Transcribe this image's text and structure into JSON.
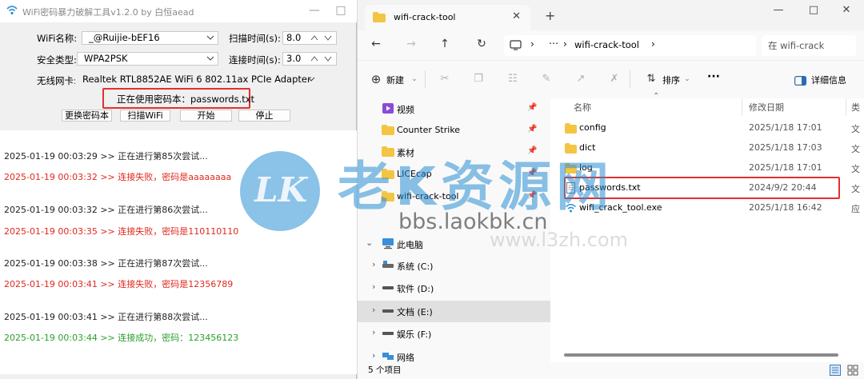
{
  "left_window": {
    "title": "WiFi密码暴力破解工具v1.2.0 by 白恒aead",
    "wifi_name_label": "WiFi名称:",
    "wifi_name_value": "_@Ruijie-bEF16",
    "security_label": "安全类型:",
    "security_value": "WPA2PSK",
    "adapter_label": "无线网卡:",
    "adapter_value": "Realtek RTL8852AE WiFi 6 802.11ax PCIe Adapter",
    "scan_time_label": "扫描时间(s):",
    "scan_time_value": "8.0",
    "connect_time_label": "连接时间(s):",
    "connect_time_value": "3.0",
    "current_pwd_text": "正在使用密码本：passwords.txt",
    "buttons": {
      "change_book": "更换密码本",
      "scan_wifi": "扫描WiFi",
      "start": "开始",
      "stop": "停止"
    },
    "log": [
      {
        "text": "2025-01-19 00:03:29 >> 正在进行第85次尝试...",
        "status": "progress"
      },
      {
        "text": "2025-01-19 00:03:32 >> 连接失败，密码是aaaaaaaa",
        "status": "fail"
      },
      {
        "text": "2025-01-19 00:03:32 >> 正在进行第86次尝试...",
        "status": "progress"
      },
      {
        "text": "2025-01-19 00:03:35 >> 连接失败，密码是110110110",
        "status": "fail"
      },
      {
        "text": "2025-01-19 00:03:38 >> 正在进行第87次尝试...",
        "status": "progress"
      },
      {
        "text": "2025-01-19 00:03:41 >> 连接失败，密码是12356789",
        "status": "fail"
      },
      {
        "text": "2025-01-19 00:03:41 >> 正在进行第88次尝试...",
        "status": "progress"
      },
      {
        "text": "2025-01-19 00:03:44 >> 连接成功，密码：123456123",
        "status": "success"
      }
    ]
  },
  "right_window": {
    "tab_title": "wifi-crack-tool",
    "breadcrumb_folder": "wifi-crack-tool",
    "search_placeholder": "在 wifi-crack",
    "commands": {
      "new": "新建",
      "sort": "排序",
      "more": "···",
      "details": "详细信息"
    },
    "nav_items": [
      {
        "label": "视频",
        "icon": "video-folder-icon",
        "pinned": true
      },
      {
        "label": "Counter Strike",
        "icon": "folder-icon",
        "pinned": true
      },
      {
        "label": "素材",
        "icon": "folder-icon",
        "pinned": true
      },
      {
        "label": "LICEcap",
        "icon": "folder-icon",
        "pinned": true
      },
      {
        "label": "wifi-crack-tool",
        "icon": "folder-icon",
        "pinned": true
      },
      {
        "label": "此电脑",
        "icon": "computer-icon",
        "expanded": true
      },
      {
        "label": "系统 (C:)",
        "icon": "drive-icon"
      },
      {
        "label": "软件 (D:)",
        "icon": "drive-icon"
      },
      {
        "label": "文档 (E:)",
        "icon": "drive-icon",
        "selected": true
      },
      {
        "label": "娱乐 (F:)",
        "icon": "drive-icon"
      },
      {
        "label": "网络",
        "icon": "network-icon"
      }
    ],
    "columns": {
      "name": "名称",
      "modified": "修改日期",
      "type": "类"
    },
    "files": [
      {
        "name": "config",
        "date": "2025/1/18 17:01",
        "type": "文",
        "icon": "folder-icon"
      },
      {
        "name": "dict",
        "date": "2025/1/18 17:03",
        "type": "文",
        "icon": "folder-icon"
      },
      {
        "name": "log",
        "date": "2025/1/18 17:01",
        "type": "文",
        "icon": "folder-icon"
      },
      {
        "name": "passwords.txt",
        "date": "2024/9/2 20:44",
        "type": "文",
        "icon": "text-file-icon"
      },
      {
        "name": "wifi_crack_tool.exe",
        "date": "2025/1/18 16:42",
        "type": "应",
        "icon": "wifi-exe-icon"
      }
    ],
    "status_text": "5 个项目"
  },
  "watermark": {
    "logo_text": "LK",
    "brand": "老K资源网",
    "url": "bbs.laokbk.cn",
    "url2": "www.l3zh.com"
  },
  "colors": {
    "highlight_red": "#e03030",
    "log_fail": "#e0281e",
    "log_success": "#2aa02a",
    "watermark_blue": "#2b8fd4"
  }
}
